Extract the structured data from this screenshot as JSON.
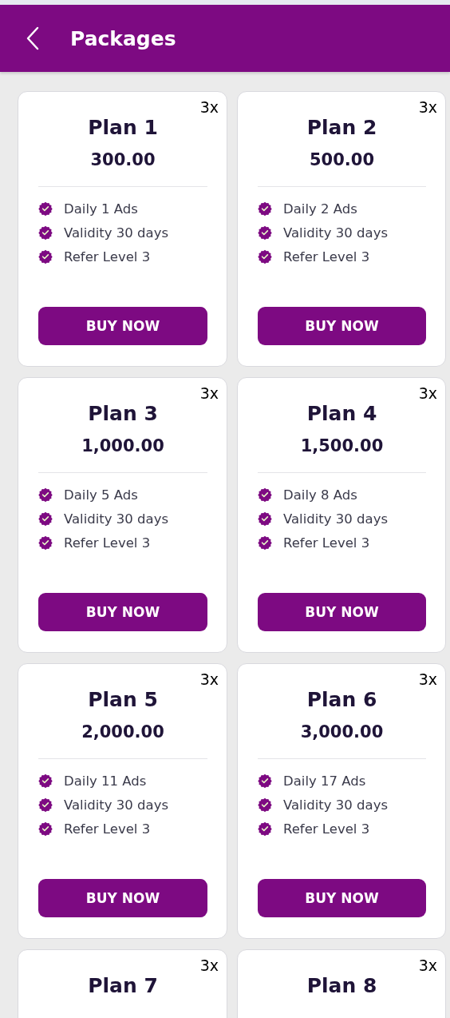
{
  "header": {
    "title": "Packages"
  },
  "plans": [
    {
      "name": "Plan 1",
      "multiplier": "3x",
      "price": "300.00",
      "features": [
        "Daily 1 Ads",
        "Validity 30 days",
        "Refer Level 3"
      ],
      "button": "BUY NOW"
    },
    {
      "name": "Plan 2",
      "multiplier": "3x",
      "price": "500.00",
      "features": [
        "Daily 2 Ads",
        "Validity 30 days",
        "Refer Level 3"
      ],
      "button": "BUY NOW"
    },
    {
      "name": "Plan 3",
      "multiplier": "3x",
      "price": "1,000.00",
      "features": [
        "Daily 5 Ads",
        "Validity 30 days",
        "Refer Level 3"
      ],
      "button": "BUY NOW"
    },
    {
      "name": "Plan 4",
      "multiplier": "3x",
      "price": "1,500.00",
      "features": [
        "Daily 8 Ads",
        "Validity 30 days",
        "Refer Level 3"
      ],
      "button": "BUY NOW"
    },
    {
      "name": "Plan 5",
      "multiplier": "3x",
      "price": "2,000.00",
      "features": [
        "Daily 11 Ads",
        "Validity 30 days",
        "Refer Level 3"
      ],
      "button": "BUY NOW"
    },
    {
      "name": "Plan 6",
      "multiplier": "3x",
      "price": "3,000.00",
      "features": [
        "Daily 17 Ads",
        "Validity 30 days",
        "Refer Level 3"
      ],
      "button": "BUY NOW"
    },
    {
      "name": "Plan 7",
      "multiplier": "3x"
    },
    {
      "name": "Plan 8",
      "multiplier": "3x"
    }
  ]
}
